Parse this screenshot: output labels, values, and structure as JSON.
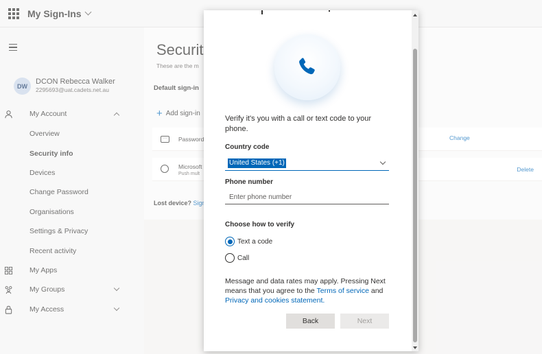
{
  "app": {
    "title": "My Sign-Ins"
  },
  "user": {
    "initials": "DW",
    "name": "DCON Rebecca Walker",
    "email": "2295693@uat.cadets.net.au"
  },
  "nav": {
    "my_account": "My Account",
    "overview": "Overview",
    "security_info": "Security info",
    "devices": "Devices",
    "change_password": "Change Password",
    "organisations": "Organisations",
    "settings_privacy": "Settings & Privacy",
    "recent_activity": "Recent activity",
    "my_apps": "My Apps",
    "my_groups": "My Groups",
    "my_access": "My Access"
  },
  "page": {
    "title": "Security",
    "subtitle": "These are the m",
    "default_signin": "Default sign-in",
    "add_signin": "Add sign-in",
    "methods": [
      {
        "label": "Password",
        "sub": "",
        "action": "Change"
      },
      {
        "label": "Microsoft",
        "sub": "Push mult",
        "action": "Delete"
      }
    ],
    "lost_device_label": "Lost device?",
    "lost_device_link": "Sign"
  },
  "modal": {
    "intro": "Verify it's you with a call or text code to your phone.",
    "country_label": "Country code",
    "country_value": "United States (+1)",
    "phone_label": "Phone number",
    "phone_placeholder": "Enter phone number",
    "verify_label": "Choose how to verify",
    "options": [
      {
        "label": "Text a code",
        "checked": true
      },
      {
        "label": "Call",
        "checked": false
      }
    ],
    "notice_prefix": "Message and data rates may apply. Pressing Next means that you agree to the",
    "terms_link": "Terms of service",
    "notice_and": "and",
    "privacy_link": "Privacy and cookies statement.",
    "back_label": "Back",
    "next_label": "Next"
  },
  "colors": {
    "accent": "#0067b8",
    "background": "#f3f2f1"
  },
  "icons": [
    "waffle-icon",
    "chevron-down-icon",
    "hamburger-icon",
    "person-icon",
    "apps-icon",
    "groups-icon",
    "lock-icon",
    "phone-icon",
    "plus-icon",
    "password-icon",
    "authenticator-icon"
  ]
}
